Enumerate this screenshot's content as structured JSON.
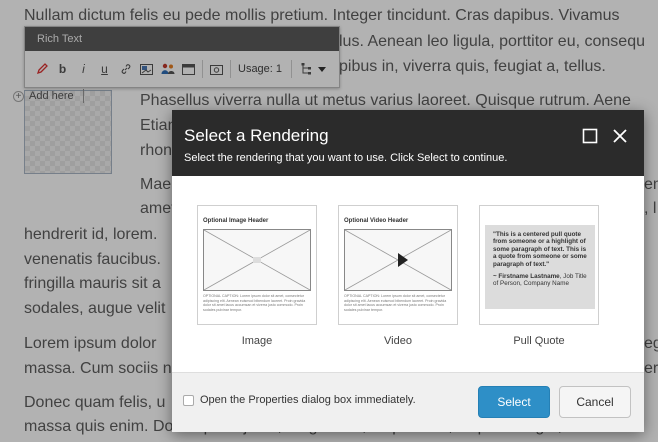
{
  "background": {
    "lines": [
      "Nullam dictum felis eu pede mollis pretium. Integer tincidunt. Cras dapibus. Vivamus",
      "lus. Aenean leo ligula, porttitor eu, consequ",
      "pibus in, viverra quis, feugiat a, tellus.",
      "Phasellus viverra nulla ut metus varius laoreet. Quisque rutrum. Aene",
      "Etian",
      "rhon",
      "Mae",
      "amet",
      "hendrerit id, lorem.",
      "venenatis faucibus.",
      "fringilla mauris sit a",
      "sodales, augue velit",
      "Lorem ipsum dolor",
      "massa. Cum sociis n",
      "Donec quam felis, u",
      "massa quis enim. Donec pede justo, fringilla vel, aliquet nec, vulputate eget, arcu. In",
      "em",
      ", l",
      "ege",
      "er"
    ],
    "add_here": "Add here"
  },
  "rich_text": {
    "title": "Rich Text",
    "usage": "Usage: 1",
    "icons": [
      "edit-icon",
      "bold-icon",
      "italic-icon",
      "underline-icon",
      "link-icon",
      "image-icon",
      "people-icon",
      "window-icon",
      "screenshot-icon",
      "tree-icon",
      "dropdown-icon"
    ]
  },
  "dialog": {
    "title": "Select a Rendering",
    "subtitle": "Select the rendering that you want to use. Click Select to continue.",
    "renderings": [
      {
        "label": "Image",
        "header": "Optional Image Header",
        "caption": "OPTIONAL CAPTION: Lorem ipsum dolor sit amet, consectetur adipiscing elit. Aenean euismod bibendum laoreet. Proin gravida dolor sit amet lacus accumsan et viverra justo commodo. Proin sodales pulvinar tempor."
      },
      {
        "label": "Video",
        "header": "Optional Video Header",
        "caption": "OPTIONAL CAPTION: Lorem ipsum dolor sit amet, consectetur adipiscing elit. Aenean euismod bibendum laoreet. Proin gravida dolor sit amet lacus accumsan et viverra justo commodo. Proin sodales pulvinar tempor."
      },
      {
        "label": "Pull Quote",
        "quote": "\"This is a centered pull quote from someone or a highlight of some paragraph of text. This is a quote from someone or some paragraph of text.\"",
        "author_name": "~ Firstname Lastname",
        "author_rest": ", Job Title of Person, Company Name"
      }
    ],
    "checkbox_label": "Open the Properties dialog box immediately.",
    "checkbox_checked": false,
    "select_label": "Select",
    "cancel_label": "Cancel"
  },
  "colors": {
    "header_bg": "#2b2b2b",
    "primary_button": "#2e8fc7",
    "overlay": "rgba(0,0,0,0.30)"
  }
}
